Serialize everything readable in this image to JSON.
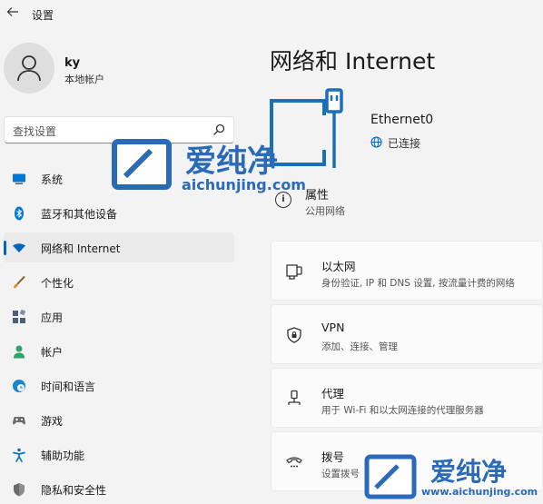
{
  "app": {
    "title": "设置",
    "back_icon": "back-arrow-icon"
  },
  "profile": {
    "name": "ky",
    "account_type": "本地帐户"
  },
  "search": {
    "placeholder": "查找设置"
  },
  "sidebar": {
    "items": [
      {
        "label": "系统",
        "icon": "system-display-icon",
        "color": "#0078d4"
      },
      {
        "label": "蓝牙和其他设备",
        "icon": "bluetooth-icon",
        "color": "#0078d4"
      },
      {
        "label": "网络和 Internet",
        "icon": "wifi-icon",
        "color": "#0067c0",
        "active": true
      },
      {
        "label": "个性化",
        "icon": "brush-icon",
        "color": "#e08a2a"
      },
      {
        "label": "应用",
        "icon": "apps-icon",
        "color": "#4a5f7a"
      },
      {
        "label": "帐户",
        "icon": "account-icon",
        "color": "#2ea36b"
      },
      {
        "label": "时间和语言",
        "icon": "globe-clock-icon",
        "color": "#1b85c9"
      },
      {
        "label": "游戏",
        "icon": "gamepad-icon",
        "color": "#6b6b6b"
      },
      {
        "label": "辅助功能",
        "icon": "accessibility-icon",
        "color": "#0a6fc2"
      },
      {
        "label": "隐私和安全性",
        "icon": "shield-icon",
        "color": "#6b6b6b"
      }
    ]
  },
  "main": {
    "title": "网络和 Internet",
    "device": {
      "name": "Ethernet0",
      "status": "已连接"
    },
    "properties": {
      "title": "属性",
      "subtitle": "公用网络"
    },
    "cards": [
      {
        "title": "以太网",
        "subtitle": "身份验证, IP 和 DNS 设置, 按流量计费的网络",
        "icon": "ethernet-icon"
      },
      {
        "title": "VPN",
        "subtitle": "添加、连接、管理",
        "icon": "vpn-shield-icon"
      },
      {
        "title": "代理",
        "subtitle": "用于 Wi-Fi 和以太网连接的代理服务器",
        "icon": "proxy-icon"
      },
      {
        "title": "拨号",
        "subtitle": "设置拨号",
        "icon": "dialup-icon"
      }
    ]
  },
  "watermarks": [
    {
      "brand": "爱纯净",
      "url": "aichunjing.com"
    },
    {
      "brand": "爱纯净",
      "url": "www.aichunjing.com"
    }
  ],
  "colors": {
    "accent": "#0067c0",
    "watermark": "#2b6ab8",
    "background": "#f3f3f3"
  }
}
